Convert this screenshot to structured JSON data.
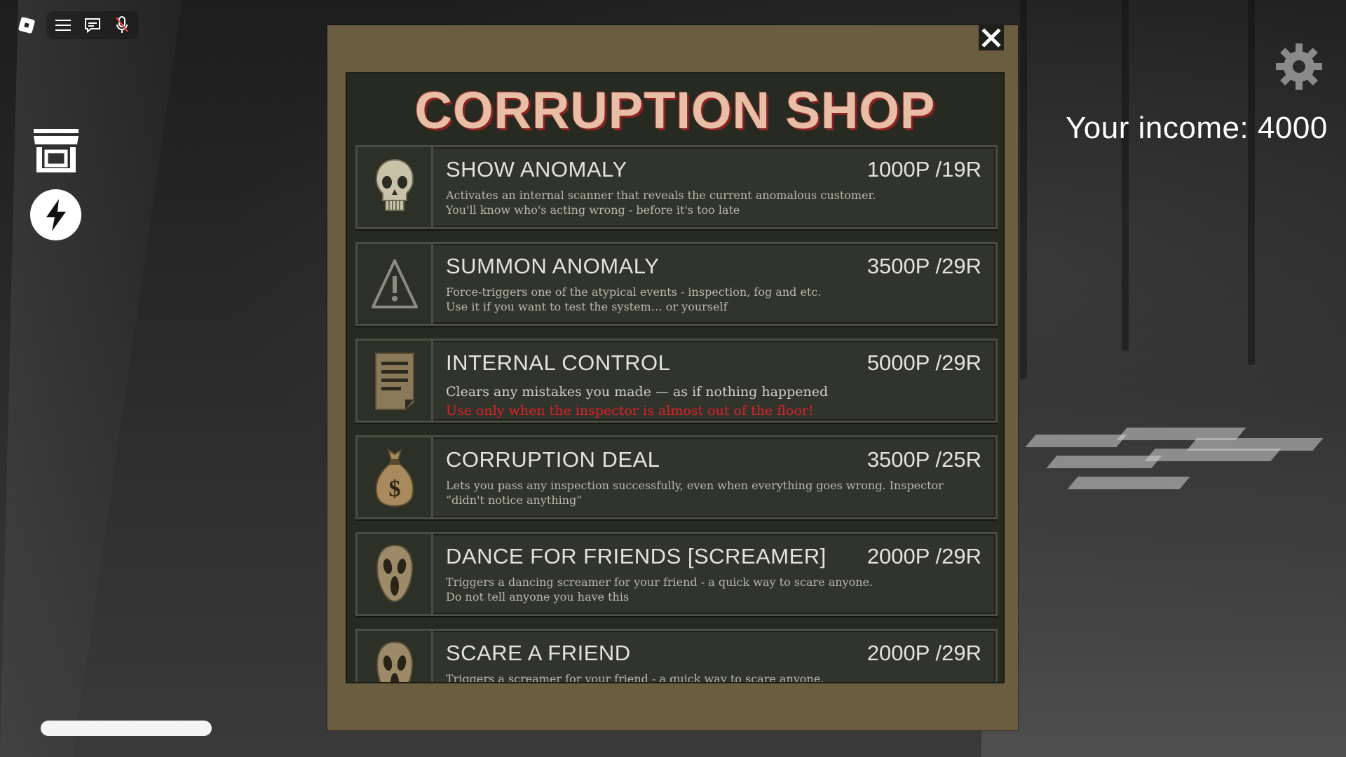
{
  "topbar": {
    "logo_icon": "roblox-logo-icon",
    "menu_icon": "hamburger-menu-icon",
    "chat_icon": "chat-icon",
    "mic_icon": "microphone-muted-icon"
  },
  "sidebar": {
    "shop_icon": "store-icon",
    "boost_icon": "lightning-bolt-icon"
  },
  "hud": {
    "settings_icon": "gear-icon",
    "income_text": "Your income: 4000",
    "progress_fraction": 0
  },
  "shop": {
    "title": "CORRUPTION SHOP",
    "close_icon": "close-icon",
    "colors": {
      "frame": "#6a5d40",
      "panel": "#262a20",
      "title": "#e8bfa6",
      "title_shadow": "#8a2222",
      "warning": "#e0202a"
    },
    "items": [
      {
        "icon": "skull-icon",
        "name": "SHOW ANOMALY",
        "price": "1000P /19R",
        "desc_line1": "Activates an internal scanner that reveals the current anomalous customer.",
        "desc_line2": "You'll know who's acting wrong - before it's too late"
      },
      {
        "icon": "warning-triangle-icon",
        "name": "SUMMON ANOMALY",
        "price": "3500P /29R",
        "desc_line1": "Force-triggers one of the atypical events - inspection, fog and etc.",
        "desc_line2": "Use it if you want to test the system… or yourself"
      },
      {
        "icon": "document-icon",
        "name": "INTERNAL CONTROL",
        "price": "5000P /29R",
        "desc_line1": "Clears any mistakes you made — as if nothing happened",
        "desc_line2": "Use only when the inspector is almost out of the floor!"
      },
      {
        "icon": "money-bag-icon",
        "name": "CORRUPTION DEAL",
        "price": "3500P /25R",
        "desc_line1": "Lets you pass any inspection successfully, even when everything goes wrong. Inspector",
        "desc_line2": "“didn't notice anything”"
      },
      {
        "icon": "scream-mask-icon",
        "name": "DANCE FOR FRIENDS [SCREAMER]",
        "price": "2000P /29R",
        "desc_line1": "Triggers a dancing screamer for your friend - a quick way to scare anyone.",
        "desc_line2": "Do not tell anyone you have this"
      },
      {
        "icon": "scream-mask-icon",
        "name": "SCARE A FRIEND",
        "price": "2000P /29R",
        "desc_line1": "Triggers a screamer for your friend - a quick way to scare anyone.",
        "desc_line2": ""
      }
    ]
  }
}
